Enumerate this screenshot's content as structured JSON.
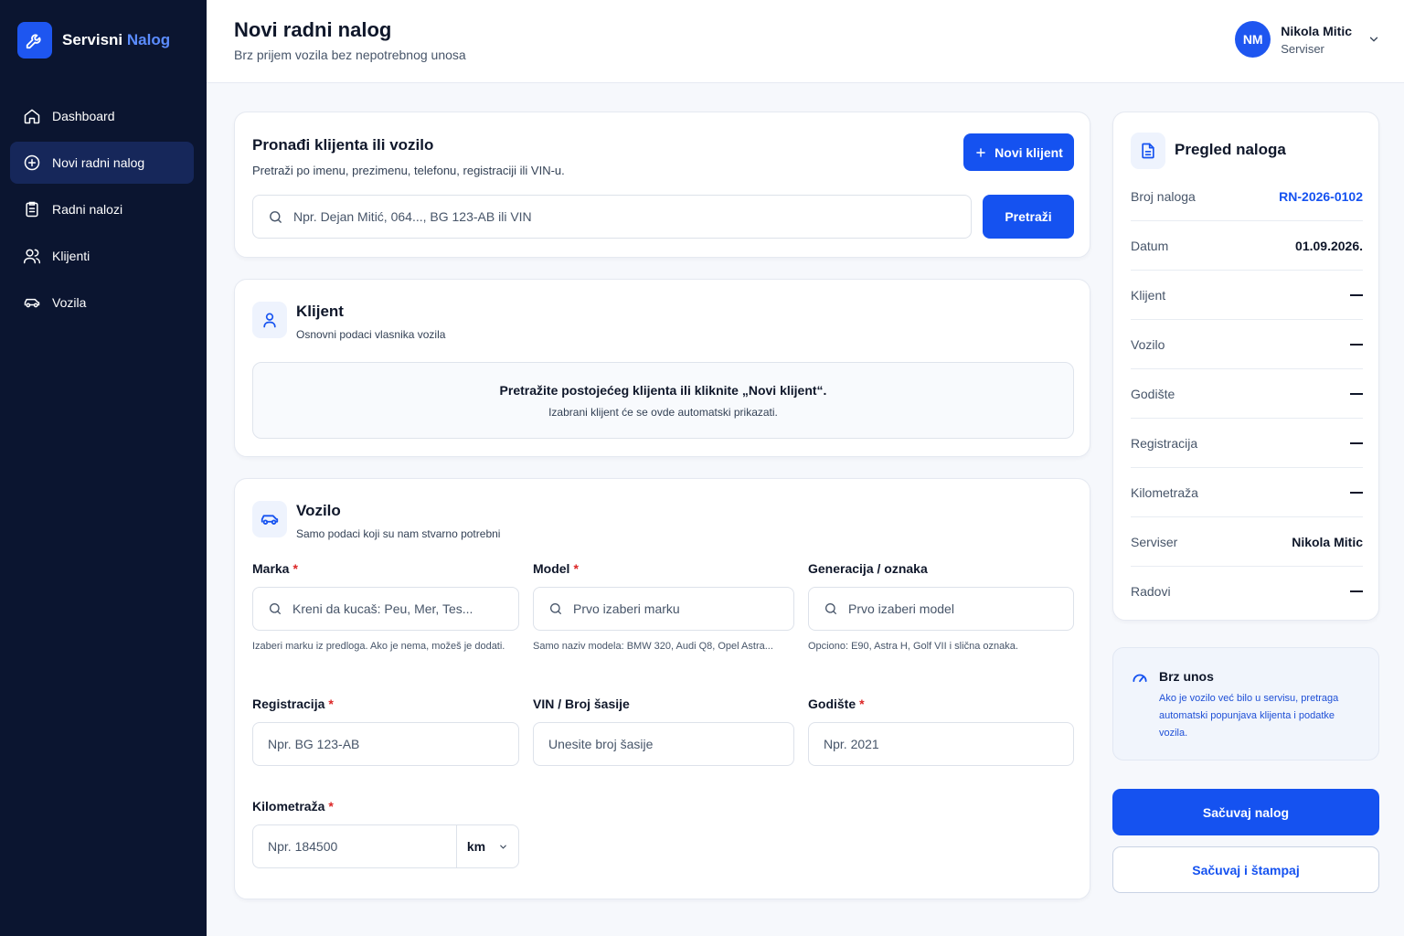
{
  "brand": {
    "name_part1": "Servisni",
    "name_part2": "Nalog"
  },
  "sidebar": {
    "items": [
      {
        "label": "Dashboard",
        "icon": "home-icon"
      },
      {
        "label": "Novi radni nalog",
        "icon": "plus-circle-icon",
        "active": true
      },
      {
        "label": "Radni nalozi",
        "icon": "clipboard-icon"
      },
      {
        "label": "Klijenti",
        "icon": "users-icon"
      },
      {
        "label": "Vozila",
        "icon": "car-icon"
      }
    ]
  },
  "header": {
    "title": "Novi radni nalog",
    "subtitle": "Brz prijem vozila bez nepotrebnog unosa",
    "user": {
      "initials": "NM",
      "name": "Nikola Mitic",
      "role": "Serviser"
    }
  },
  "search": {
    "title": "Pronađi klijenta ili vozilo",
    "subtitle": "Pretraži po imenu, prezimenu, telefonu, registraciji ili VIN-u.",
    "new_client_label": "Novi klijent",
    "placeholder": "Npr. Dejan Mitić, 064..., BG 123-AB ili VIN",
    "search_button": "Pretraži"
  },
  "client": {
    "title": "Klijent",
    "subtitle": "Osnovni podaci vlasnika vozila",
    "empty_main": "Pretražite postojećeg klijenta ili kliknite „Novi klijent“.",
    "empty_sub": "Izabrani klijent će se ovde automatski prikazati."
  },
  "vehicle": {
    "title": "Vozilo",
    "subtitle": "Samo podaci koji su nam stvarno potrebni",
    "required_mark": "*",
    "make": {
      "label": "Marka",
      "placeholder": "Kreni da kucaš: Peu, Mer, Tes...",
      "hint": "Izaberi marku iz predloga. Ako je nema, možeš je dodati."
    },
    "model": {
      "label": "Model",
      "placeholder": "Prvo izaberi marku",
      "hint": "Samo naziv modela: BMW 320, Audi Q8, Opel Astra..."
    },
    "generation": {
      "label": "Generacija / oznaka",
      "placeholder": "Prvo izaberi model",
      "hint": "Opciono: E90, Astra H, Golf VII i slična oznaka."
    },
    "registration": {
      "label": "Registracija",
      "placeholder": "Npr. BG 123-AB"
    },
    "vin": {
      "label": "VIN / Broj šasije",
      "placeholder": "Unesite broj šasije"
    },
    "year": {
      "label": "Godište",
      "placeholder": "Npr. 2021"
    },
    "mileage": {
      "label": "Kilometraža",
      "placeholder": "Npr. 184500",
      "unit": "km"
    }
  },
  "summary": {
    "title": "Pregled naloga",
    "rows": [
      {
        "key": "Broj naloga",
        "value": "RN-2026-0102"
      },
      {
        "key": "Datum",
        "value": "01.09.2026."
      },
      {
        "key": "Klijent",
        "value": ""
      },
      {
        "key": "Vozilo",
        "value": ""
      },
      {
        "key": "Godište",
        "value": ""
      },
      {
        "key": "Registracija",
        "value": ""
      },
      {
        "key": "Kilometraža",
        "value": ""
      },
      {
        "key": "Serviser",
        "value": "Nikola Mitic"
      },
      {
        "key": "Radovi",
        "value": ""
      }
    ]
  },
  "quick": {
    "title": "Brz unos",
    "body": "Ako je vozilo već bilo u servisu, pretraga automatski popunjava klijenta i podatke vozila."
  },
  "actions": {
    "save": "Sačuvaj nalog",
    "save_print": "Sačuvaj i štampaj"
  },
  "colors": {
    "sidebar": "#0b1530",
    "accent": "#1552f0",
    "required": "#dc2626"
  }
}
